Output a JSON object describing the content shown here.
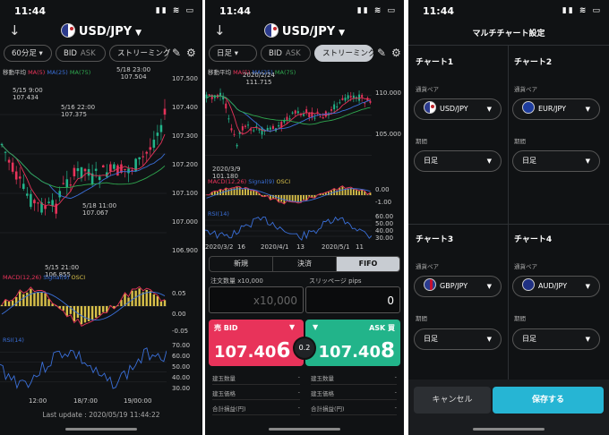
{
  "status": {
    "time": "11:44",
    "icons": "▮▮ ≋ ▭"
  },
  "screen1": {
    "pair": "USD/JPY",
    "timeframe": "60分足",
    "bid": "BID",
    "ask": "ASK",
    "streaming": "ストリーミング",
    "legend": {
      "ma_label": "移動平均",
      "ma5": "MA(5)",
      "ma25": "MA(25)",
      "ma75": "MA(75)"
    },
    "ann": [
      {
        "line1": "5/18 23:00",
        "line2": "107.504"
      },
      {
        "line1": "5/15 9:00",
        "line2": "107.434"
      },
      {
        "line1": "5/16 22:00",
        "line2": "107.375"
      },
      {
        "line1": "5/18 11:00",
        "line2": "107.067"
      },
      {
        "line1": "5/15 21:00",
        "line2": "106.855"
      }
    ],
    "yticks": [
      "107.500",
      "107.400",
      "107.300",
      "107.200",
      "107.100",
      "107.000",
      "106.900"
    ],
    "macd": {
      "legend": "MACD(12,26)",
      "signal": "Signal(9)",
      "osci": "OSCI",
      "t1": "0.05",
      "t2": "0.00",
      "t3": "-0.05"
    },
    "rsi": {
      "legend": "RSI(14)",
      "t": [
        "70.00",
        "60.00",
        "50.00",
        "40.00",
        "30.00"
      ]
    },
    "xticks": [
      "12:00",
      "18/7:00",
      "19/00:00"
    ],
    "last_update": "Last update : 2020/05/19 11:44:22"
  },
  "screen2": {
    "pair": "USD/JPY",
    "timeframe": "日足",
    "bid": "BID",
    "ask": "ASK",
    "streaming": "ストリーミング",
    "legend": {
      "ma_label": "移動平均",
      "ma5": "MA(5)",
      "ma25": "MA(25)",
      "ma75": "MA(75)"
    },
    "ann_top": {
      "line1": "2020/2/24",
      "line2": "111.715"
    },
    "ann_bot": {
      "line1": "2020/3/9",
      "line2": "101.180"
    },
    "yticks": [
      "110.000",
      "105.000"
    ],
    "macd": {
      "legend": "MACD(12,26)",
      "signal": "Signal(9)",
      "osci": "OSCI",
      "t1": "0.00",
      "t2": "-1.00"
    },
    "rsi": {
      "legend": "RSI(14)",
      "t": [
        "60.00",
        "50.00",
        "40.00",
        "30.00"
      ]
    },
    "xticks": [
      "2020/3/2",
      "16",
      "2020/4/1",
      "13",
      "2020/5/1",
      "11"
    ],
    "tabs": [
      "新規",
      "決済",
      "FIFO"
    ],
    "qty_label": "注文数量 x10,000",
    "qty_placeholder": "x10,000",
    "slip_label": "スリッページ pips",
    "slip_value": "0",
    "bid_head": "売 BID",
    "ask_head": "ASK 買",
    "bid_price_main": "107.40",
    "bid_price_last": "6",
    "ask_price_main": "107.40",
    "ask_price_last": "8",
    "spread": "0.2",
    "info": [
      {
        "k": "建玉数量",
        "v": "-",
        "k2": "建玉数量",
        "v2": "-"
      },
      {
        "k": "建玉価格",
        "v": "-",
        "k2": "建玉価格",
        "v2": "-"
      },
      {
        "k": "合計損益(円)",
        "v": "-",
        "k2": "合計損益(円)",
        "v2": "-"
      }
    ]
  },
  "screen3": {
    "title": "マルチチャート設定",
    "pair_label": "通貨ペア",
    "period_label": "期間",
    "charts": [
      {
        "name": "チャート1",
        "pair": "USD/JPY",
        "period": "日足"
      },
      {
        "name": "チャート2",
        "pair": "EUR/JPY",
        "period": "日足"
      },
      {
        "name": "チャート3",
        "pair": "GBP/JPY",
        "period": "日足"
      },
      {
        "name": "チャート4",
        "pair": "AUD/JPY",
        "period": "日足"
      }
    ],
    "cancel": "キャンセル",
    "save": "保存する"
  },
  "colors": {
    "up": "#e8335a",
    "down": "#22b48a",
    "ma5": "#e8335a",
    "ma25": "#3a6fd8",
    "ma75": "#2fa84f",
    "macd": "#e8335a",
    "signal": "#3a6fd8",
    "osci": "#d8c04a",
    "rsi": "#3a6fd8",
    "save": "#26b5d4"
  }
}
